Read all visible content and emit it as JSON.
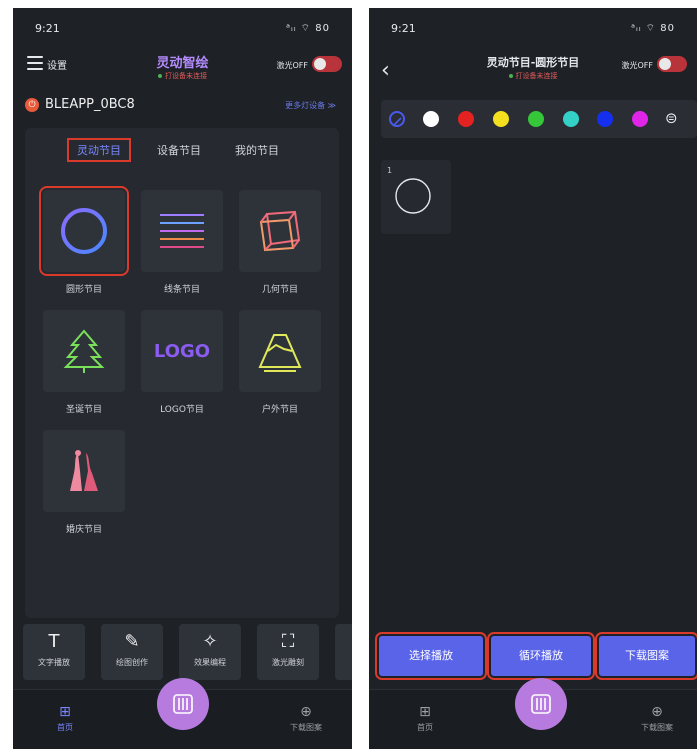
{
  "left": {
    "status": {
      "time": "9:21",
      "icons": "ᵃᵢₗ ⌔ 80"
    },
    "header": {
      "settings": "设置",
      "title": "灵动智绘",
      "subtitle": "打设备未连接",
      "laser_label": "激光OFF"
    },
    "device": {
      "icon": "⏻",
      "name": "BLEAPP_0BC8",
      "more": "更多灯设备 ≫"
    },
    "tabs": [
      "灵动节目",
      "设备节目",
      "我的节目"
    ],
    "grid": [
      {
        "label": "圆形节目",
        "icon": "circle-icon"
      },
      {
        "label": "线条节目",
        "icon": "lines-icon"
      },
      {
        "label": "几何节目",
        "icon": "cube-icon"
      },
      {
        "label": "圣诞节目",
        "icon": "tree-icon"
      },
      {
        "label": "LOGO节目",
        "icon": "logo-icon",
        "logo_text": "LOGO"
      },
      {
        "label": "户外节目",
        "icon": "mountain-icon"
      },
      {
        "label": "婚庆节目",
        "icon": "wedding-icon"
      }
    ],
    "toolbar": [
      {
        "icon": "T",
        "label": "文字播放"
      },
      {
        "icon": "✎",
        "label": "绘图创作"
      },
      {
        "icon": "✧",
        "label": "效果编程"
      },
      {
        "icon": "⛶",
        "label": "激光雕刻"
      }
    ],
    "nav": {
      "home_label": "首页",
      "download_label": "下载图案",
      "home_icon": "⊞",
      "download_icon": "⊕"
    }
  },
  "right": {
    "status": {
      "time": "9:21",
      "icons": "ᵃᵢₗ ⌔ 80"
    },
    "header": {
      "back": "‹",
      "title": "灵动节目-圆形节目",
      "subtitle": "打设备未连接",
      "laser_label": "激光OFF"
    },
    "palette": {
      "colors": [
        "#4a5af0",
        "#ffffff",
        "#e52222",
        "#f5e020",
        "#36c63a",
        "#34d1c8",
        "#1430ee",
        "#e025e8"
      ],
      "more_icon": "⊜"
    },
    "preset": {
      "number": "1"
    },
    "actions": [
      "选择播放",
      "循环播放",
      "下载图案"
    ],
    "nav": {
      "home_label": "首页",
      "download_label": "下载图案",
      "home_icon": "⊞",
      "download_icon": "⊕"
    }
  },
  "colors": {
    "accent": "#5a64e8",
    "highlight": "#d93a2b",
    "bg": "#1e2227",
    "fab": "#b77be0"
  }
}
